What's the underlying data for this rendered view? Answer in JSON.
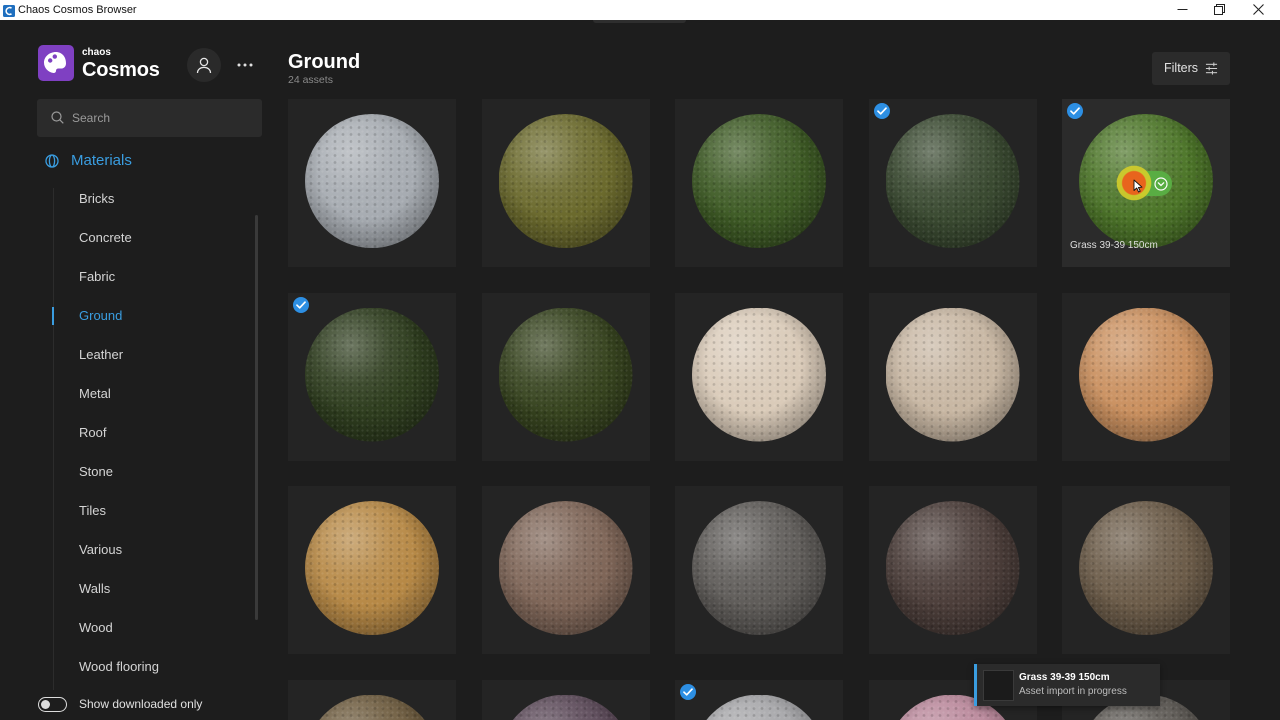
{
  "window": {
    "title": "Chaos Cosmos Browser",
    "icon": "app-icon",
    "controls": [
      "minimize-icon",
      "restore-icon",
      "close-icon"
    ]
  },
  "brand": {
    "small": "chaos",
    "large": "Cosmos",
    "icon": "cosmos-logo-icon"
  },
  "header_actions": {
    "account_icon": "user-icon",
    "more_icon": "more-icon"
  },
  "search": {
    "placeholder": "Search",
    "icon": "search-icon"
  },
  "sidebar": {
    "section": {
      "label": "Materials",
      "icon": "materials-icon"
    },
    "items": [
      {
        "label": "Bricks"
      },
      {
        "label": "Concrete"
      },
      {
        "label": "Fabric"
      },
      {
        "label": "Ground",
        "active": true
      },
      {
        "label": "Leather"
      },
      {
        "label": "Metal"
      },
      {
        "label": "Roof"
      },
      {
        "label": "Stone"
      },
      {
        "label": "Tiles"
      },
      {
        "label": "Various"
      },
      {
        "label": "Walls"
      },
      {
        "label": "Wood"
      },
      {
        "label": "Wood flooring"
      }
    ],
    "toggle": {
      "label": "Show downloaded only",
      "on": false
    }
  },
  "main": {
    "title": "Ground",
    "count": "24 assets",
    "filters_label": "Filters",
    "filters_icon": "sliders-icon"
  },
  "assets": [
    {
      "swatch": "#a7acb2",
      "downloaded": false
    },
    {
      "swatch": "#6b6a2d",
      "downloaded": false
    },
    {
      "swatch": "#3e5b25",
      "downloaded": false
    },
    {
      "swatch": "#3a4a31",
      "downloaded": true
    },
    {
      "swatch": "#4d7629",
      "downloaded": true,
      "hovered": true,
      "label": "Grass 39-39 150cm"
    },
    {
      "swatch": "#2f3e1f",
      "downloaded": true
    },
    {
      "swatch": "#37441f",
      "downloaded": false
    },
    {
      "swatch": "#dacbb9",
      "downloaded": false
    },
    {
      "swatch": "#c8b7a3",
      "downloaded": false
    },
    {
      "swatch": "#ca905f",
      "downloaded": false
    },
    {
      "swatch": "#b78946",
      "downloaded": false
    },
    {
      "swatch": "#7f6658",
      "downloaded": false
    },
    {
      "swatch": "#5f5c59",
      "downloaded": false
    },
    {
      "swatch": "#4c3e3a",
      "downloaded": false
    },
    {
      "swatch": "#6c5c49",
      "downloaded": false
    },
    {
      "swatch": "#6f5d40",
      "downloaded": false
    },
    {
      "swatch": "#5d4b5a",
      "downloaded": false
    },
    {
      "swatch": "#a6a6a9",
      "downloaded": true
    },
    {
      "swatch": "#ba889b",
      "downloaded": false
    },
    {
      "swatch": "#5e5a55",
      "downloaded": false
    }
  ],
  "toast": {
    "title": "Grass 39-39 150cm",
    "message": "Asset import in progress"
  },
  "colors": {
    "accent": "#3a9de0",
    "brand": "#7f40c2",
    "check": "#2d8fe3",
    "download": "#59ad43",
    "highlight": "#e8641d"
  }
}
